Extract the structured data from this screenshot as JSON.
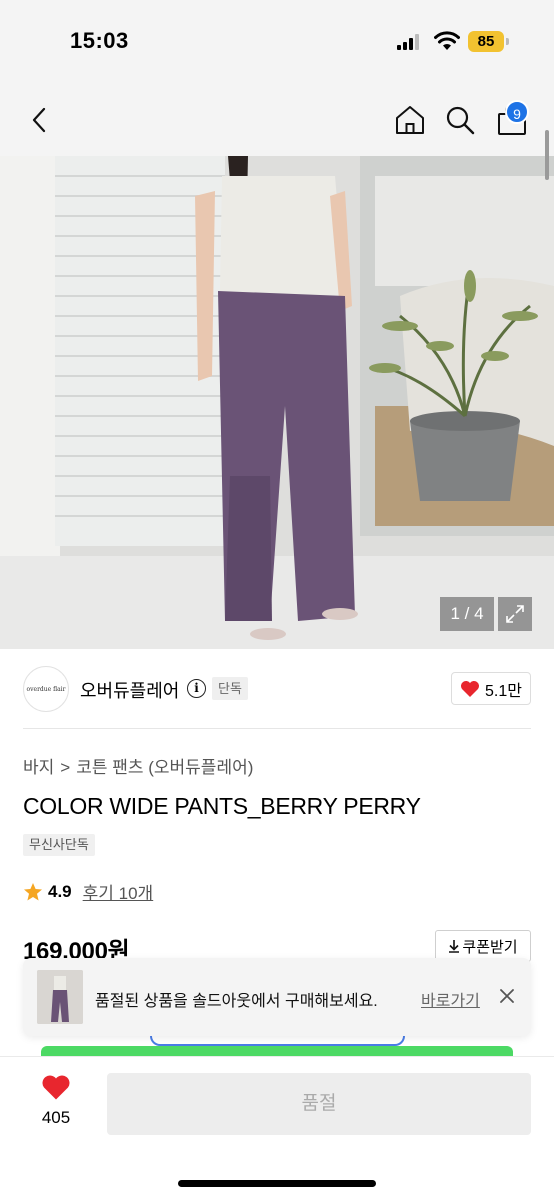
{
  "status_bar": {
    "time": "15:03",
    "battery": "85"
  },
  "nav": {
    "cart_count": "9"
  },
  "hero": {
    "counter": "1 / 4"
  },
  "brand": {
    "logo_text": "overdue flair",
    "name": "오버듀플레어",
    "info_symbol": "i",
    "tag": "단독",
    "likes": "5.1만"
  },
  "breadcrumb": {
    "category": "바지",
    "separator": ">",
    "subcategory": "코튼 팬츠 (오버듀플레어)"
  },
  "product": {
    "title": "COLOR WIDE PANTS_BERRY PERRY",
    "tag": "무신사단독",
    "rating": "4.9",
    "reviews": "후기 10개",
    "price": "169,000원"
  },
  "coupon": {
    "label": "쿠폰받기"
  },
  "banner": {
    "message": "품절된 상품을 솔드아웃에서 구매해보세요.",
    "link_label": "바로가기"
  },
  "bottom": {
    "like_count": "405",
    "buy_label": "품절"
  },
  "colors": {
    "accent_blue": "#1e73e6",
    "heart_red": "#e8262e",
    "star_orange": "#f5a623",
    "battery_yellow": "#f2c230"
  }
}
